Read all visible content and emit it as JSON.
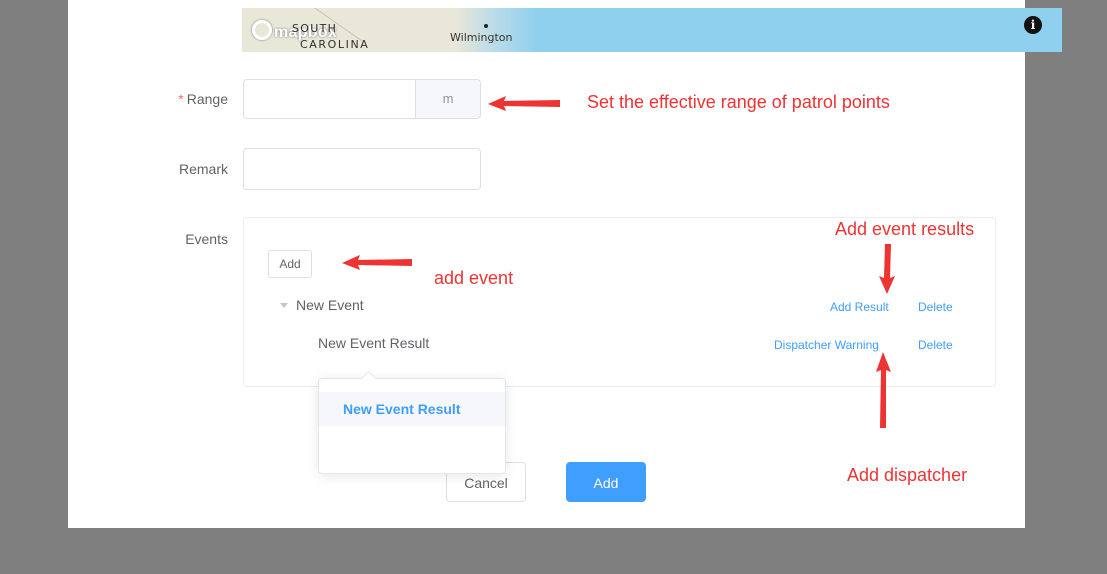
{
  "map": {
    "attribution": "mapbox",
    "state_line1": "SOUTH",
    "state_line2": "CAROLINA",
    "city": "Wilmington",
    "info_glyph": "i"
  },
  "form": {
    "range": {
      "label": "Range",
      "required_mark": "*",
      "value": "",
      "unit": "m"
    },
    "remark": {
      "label": "Remark",
      "value": ""
    },
    "events": {
      "label": "Events",
      "add_button": "Add",
      "event_name": "New Event",
      "event_actions": [
        "Add Result",
        "Delete"
      ],
      "result_name": "New Event Result",
      "result_actions": [
        "Dispatcher Warning",
        "Delete"
      ]
    }
  },
  "dropdown": {
    "options": [
      "New Event Result"
    ]
  },
  "footer": {
    "cancel_label": "Cancel",
    "add_label": "Add"
  },
  "annotations": {
    "range_note": "Set the effective range of patrol points",
    "add_event_note": "add event",
    "add_result_note": "Add event results",
    "dispatcher_note": "Add dispatcher"
  },
  "colors": {
    "accent": "#409eff",
    "annotation": "#ee3333",
    "overlay": "#7f7f7f"
  }
}
